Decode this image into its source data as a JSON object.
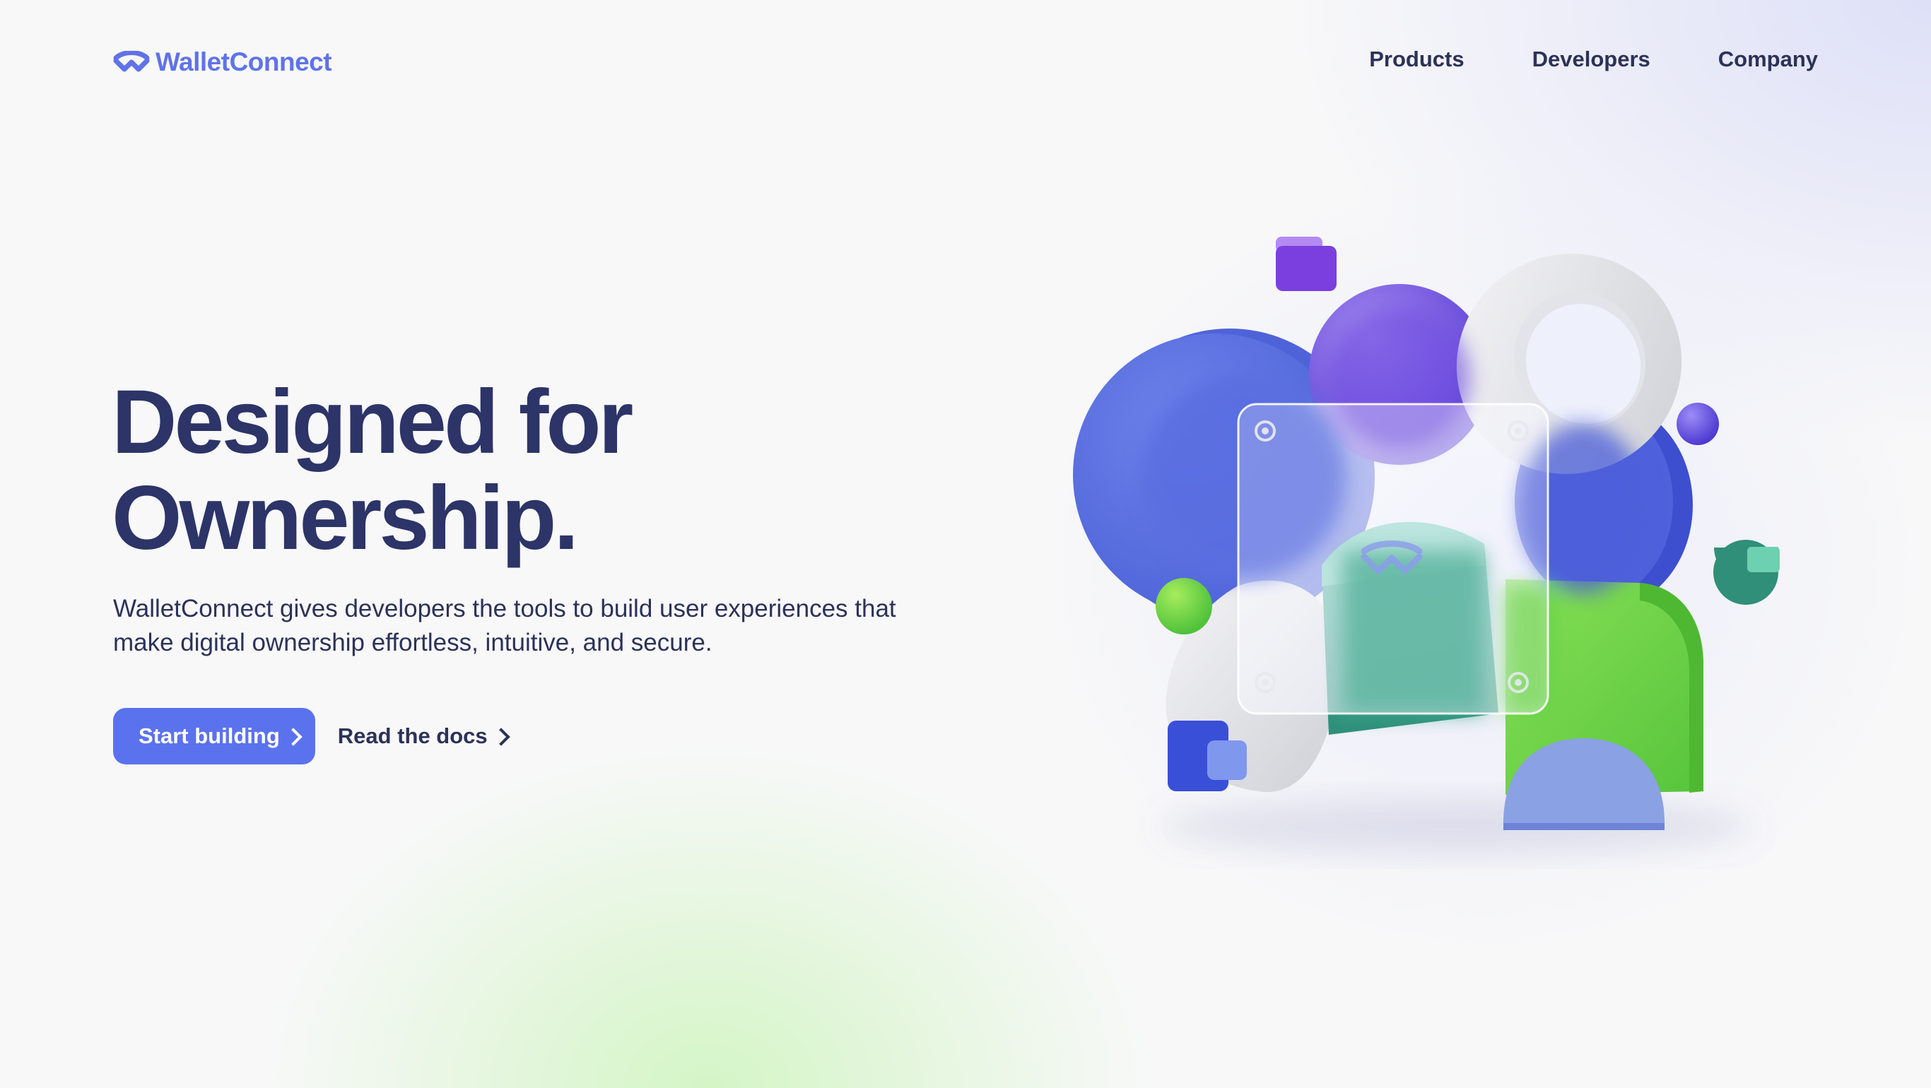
{
  "brand": {
    "name": "WalletConnect",
    "color": "#5f73e8"
  },
  "nav": {
    "items": [
      {
        "label": "Products"
      },
      {
        "label": "Developers"
      },
      {
        "label": "Company"
      }
    ]
  },
  "hero": {
    "headline_line1": "Designed for",
    "headline_line2": "Ownership.",
    "subtext": "WalletConnect gives developers the tools to build user experiences that make digital ownership effortless, intuitive, and secure.",
    "primary_cta": "Start building",
    "secondary_cta": "Read the docs"
  },
  "colors": {
    "primary_button": "#5b72ee",
    "heading": "#2c3468",
    "body_text": "#2c3257"
  },
  "icons": {
    "logo": "walletconnect-wave-icon",
    "cta_arrow": "chevron-right-icon"
  }
}
